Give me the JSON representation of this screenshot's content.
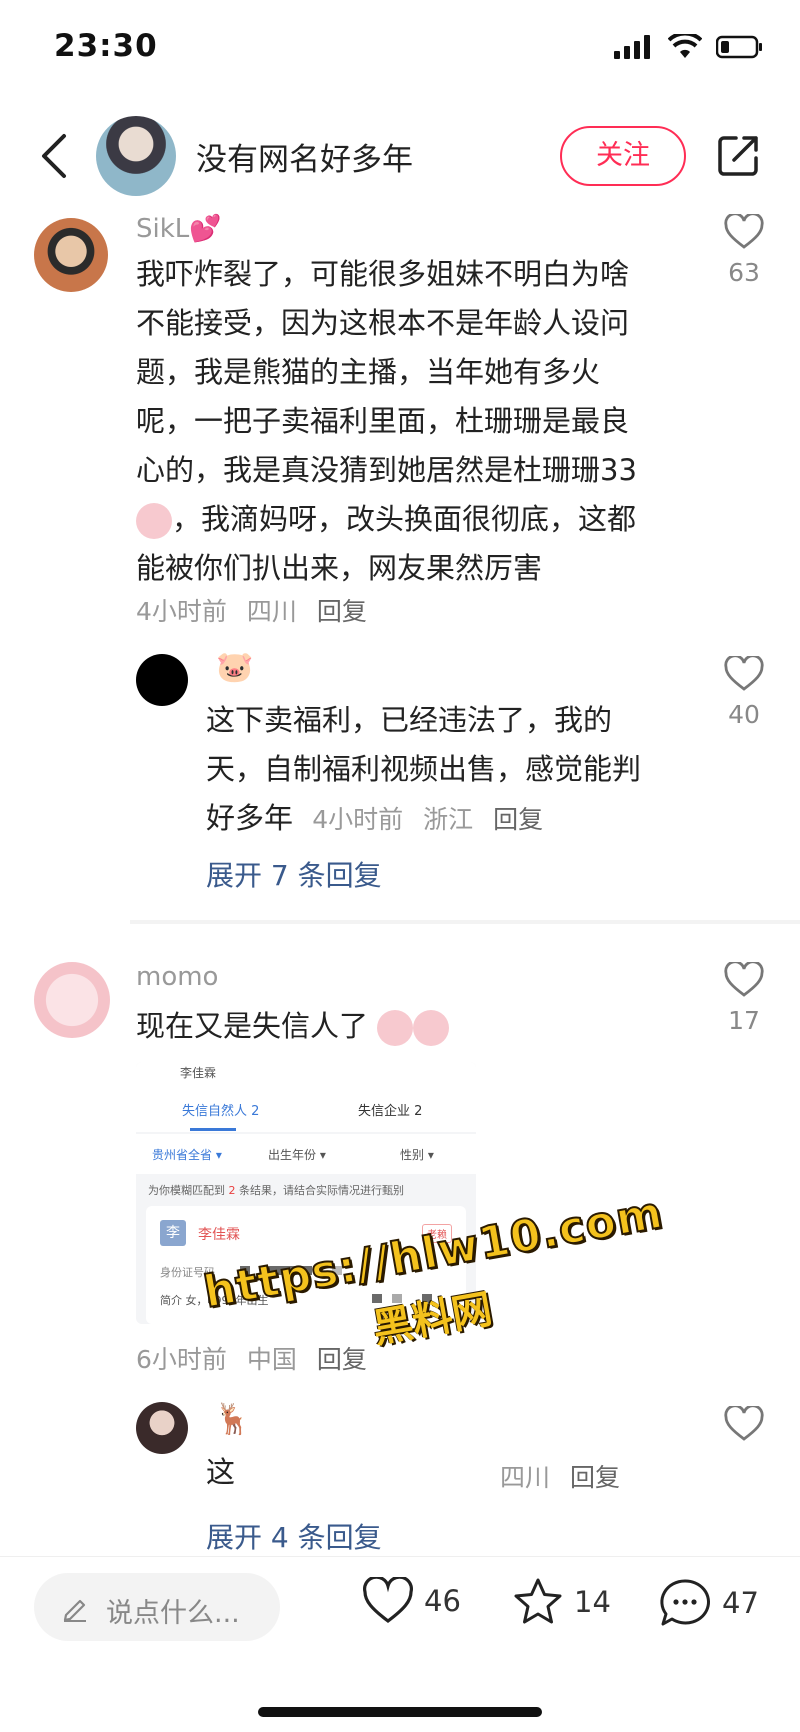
{
  "status_bar": {
    "time": "23:30"
  },
  "header": {
    "author_name": "没有网名好多年",
    "follow_label": "关注"
  },
  "comments": [
    {
      "username": "SikL💕",
      "text_lines": [
        "我吓炸裂了，可能很多姐妹不明白为啥",
        "不能接受，因为这根本不是年龄人设问",
        "题，我是熊猫的主播，当年她有多火",
        "呢，一把子卖福利里面，杜珊珊是最良",
        "心的，我是真没猜到她居然是杜珊珊33",
        "，我滴妈呀，改头换面很彻底，这都",
        "能被你们扒出来，网友果然厉害"
      ],
      "time": "4小时前",
      "location": "四川",
      "reply_label": "回复",
      "likes": "63"
    },
    {
      "username": "🐷",
      "text_lines": [
        "这下卖福利，已经违法了，我的",
        "天，自制福利视频出售，感觉能判",
        "好多年"
      ],
      "time": "4小时前",
      "location": "浙江",
      "reply_label": "回复",
      "likes": "40",
      "expand_label": "展开 7 条回复"
    },
    {
      "username": "momo",
      "text": "现在又是失信人了",
      "time": "6小时前",
      "location": "中国",
      "reply_label": "回复",
      "likes": "17"
    },
    {
      "username": "🦌",
      "text": "这",
      "location": "四川",
      "reply_label": "回复",
      "expand_label": "展开 4 条回复"
    }
  ],
  "embedded_screenshot": {
    "search_text": "李佳霖",
    "tab_person": "失信自然人 2",
    "tab_company": "失信企业 2",
    "filter_province": "贵州省全省 ▾",
    "filter_year": "出生年份 ▾",
    "filter_gender": "性别 ▾",
    "notice_prefix": "为你模糊匹配到 ",
    "notice_count": "2",
    "notice_suffix": " 条结果，请结合实际情况进行甄别",
    "card_initial": "李",
    "card_name": "李佳霖",
    "card_badge": "老赖",
    "id_label": "身份证号码",
    "summary": "简介   女，1996年出生"
  },
  "watermark": {
    "url": "https://hlw10.com",
    "sub": "黑料网"
  },
  "bottom_bar": {
    "input_placeholder": "说点什么...",
    "likes": "46",
    "favorites": "14",
    "comments": "47"
  },
  "colors": {
    "accent": "#ff2d55",
    "link": "#3a5a8c",
    "meta": "#999999"
  }
}
